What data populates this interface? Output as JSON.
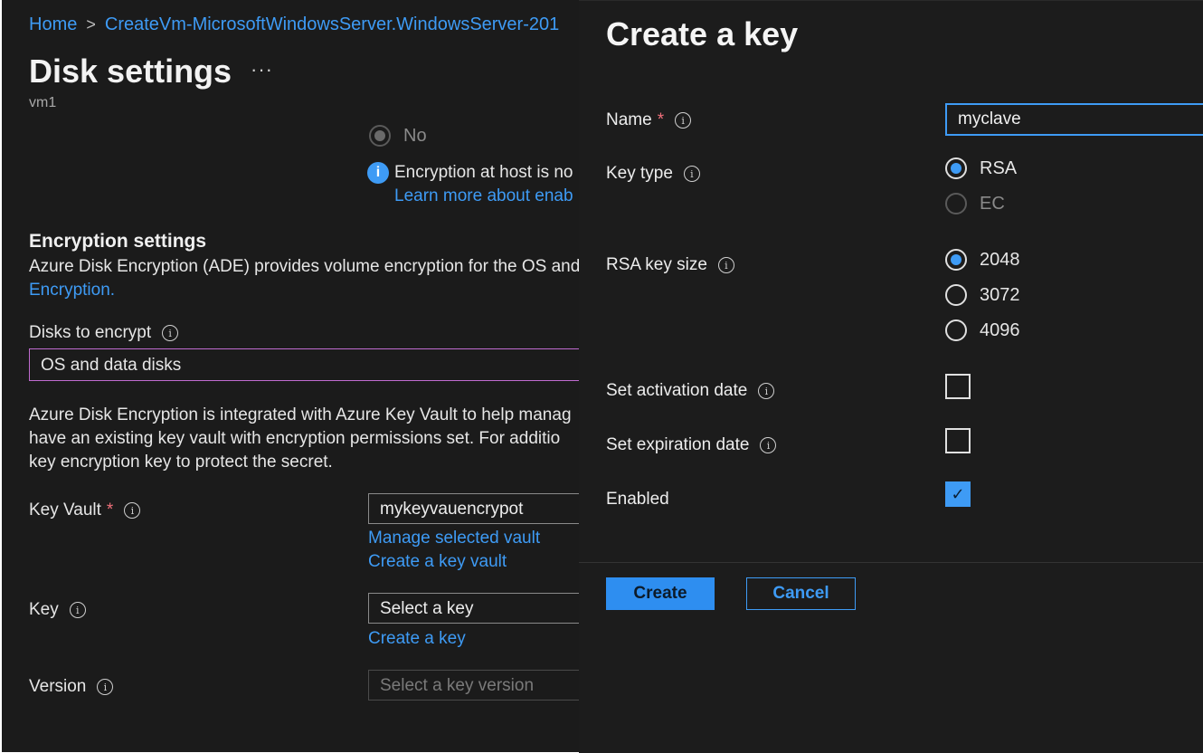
{
  "breadcrumb": {
    "home": "Home",
    "separator": ">",
    "current": "CreateVm-MicrosoftWindowsServer.WindowsServer-201"
  },
  "page": {
    "title": "Disk settings",
    "more": "···",
    "subtitle": "vm1"
  },
  "host_encryption": {
    "no_label": "No",
    "info_line1": "Encryption at host is no",
    "info_line2": "Learn more about enab"
  },
  "encryption_settings": {
    "title": "Encryption settings",
    "desc_line1": "Azure Disk Encryption (ADE) provides volume encryption for the OS and",
    "desc_link": "Encryption."
  },
  "disks_to_encrypt": {
    "label": "Disks to encrypt",
    "value": "OS and data disks"
  },
  "keyvault_paragraph": [
    "Azure Disk Encryption is integrated with Azure Key Vault to help manag",
    "have an existing key vault with encryption permissions set. For additio",
    "key encryption key to protect the secret."
  ],
  "key_vault": {
    "label": "Key Vault",
    "required": "*",
    "value": "mykeyvauencrypot",
    "manage_link": "Manage selected vault",
    "create_link": "Create a key vault"
  },
  "key": {
    "label": "Key",
    "placeholder": "Select a key",
    "create_link": "Create a key"
  },
  "version": {
    "label": "Version",
    "placeholder": "Select a key version"
  },
  "panel": {
    "title": "Create a key",
    "name_label": "Name",
    "name_required": "*",
    "name_value": "myclave",
    "key_type_label": "Key type",
    "key_type_options": [
      "RSA",
      "EC"
    ],
    "key_type_selected": "RSA",
    "rsa_size_label": "RSA key size",
    "rsa_size_options": [
      "2048",
      "3072",
      "4096"
    ],
    "rsa_size_selected": "2048",
    "activation_label": "Set activation date",
    "activation_checked": false,
    "expiration_label": "Set expiration date",
    "expiration_checked": false,
    "enabled_label": "Enabled",
    "enabled_checked": true,
    "create_button": "Create",
    "cancel_button": "Cancel"
  },
  "colors": {
    "accent": "#3e9bf5",
    "background": "#1b1b1b",
    "required": "#f1707b"
  }
}
